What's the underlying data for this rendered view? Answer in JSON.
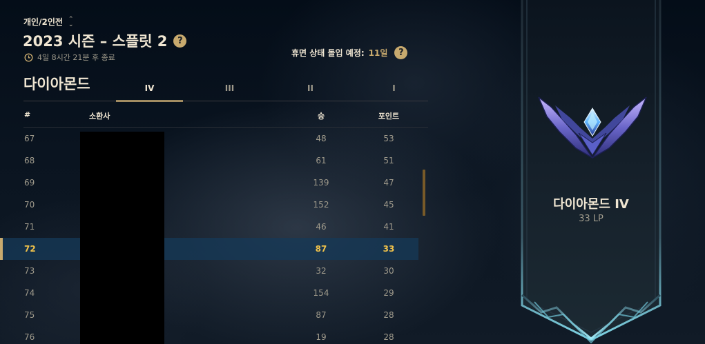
{
  "queue": {
    "label": "개인/2인전",
    "chevron_icon": "sort-chevrons-icon"
  },
  "season": {
    "title": "2023 시즌 – 스플릿 2",
    "help_glyph": "?"
  },
  "timer": {
    "text": "4일 8시간 21분 후 종료",
    "icon": "clock-icon"
  },
  "decay": {
    "label": "휴면 상태 돌입 예정:",
    "days": "11일",
    "help_glyph": "?"
  },
  "tier_name": "다이아몬드",
  "division_tabs": [
    {
      "label": "IV",
      "active": true
    },
    {
      "label": "III",
      "active": false
    },
    {
      "label": "II",
      "active": false
    },
    {
      "label": "I",
      "active": false
    }
  ],
  "table": {
    "columns": {
      "rank": "#",
      "summoner": "소환사",
      "wins": "승",
      "points": "포인트"
    },
    "rows": [
      {
        "rank": "67",
        "wins": "48",
        "points": "53"
      },
      {
        "rank": "68",
        "wins": "61",
        "points": "51"
      },
      {
        "rank": "69",
        "wins": "139",
        "points": "47"
      },
      {
        "rank": "70",
        "wins": "152",
        "points": "45"
      },
      {
        "rank": "71",
        "wins": "46",
        "points": "41"
      },
      {
        "rank": "72",
        "wins": "87",
        "points": "33",
        "highlighted": true
      },
      {
        "rank": "73",
        "wins": "32",
        "points": "30"
      },
      {
        "rank": "74",
        "wins": "154",
        "points": "29"
      },
      {
        "rank": "75",
        "wins": "87",
        "points": "28"
      },
      {
        "rank": "76",
        "wins": "19",
        "points": "28"
      }
    ]
  },
  "banner": {
    "tier": "다이아몬드 IV",
    "lp": "33 LP",
    "emblem_icon": "diamond-emblem-icon"
  },
  "colors": {
    "gold": "#c8aa6e",
    "highlight_text": "#f0c24b",
    "text_light": "#f0e6d2",
    "text_muted": "#a09b8c",
    "highlight_row": "#163a58"
  }
}
